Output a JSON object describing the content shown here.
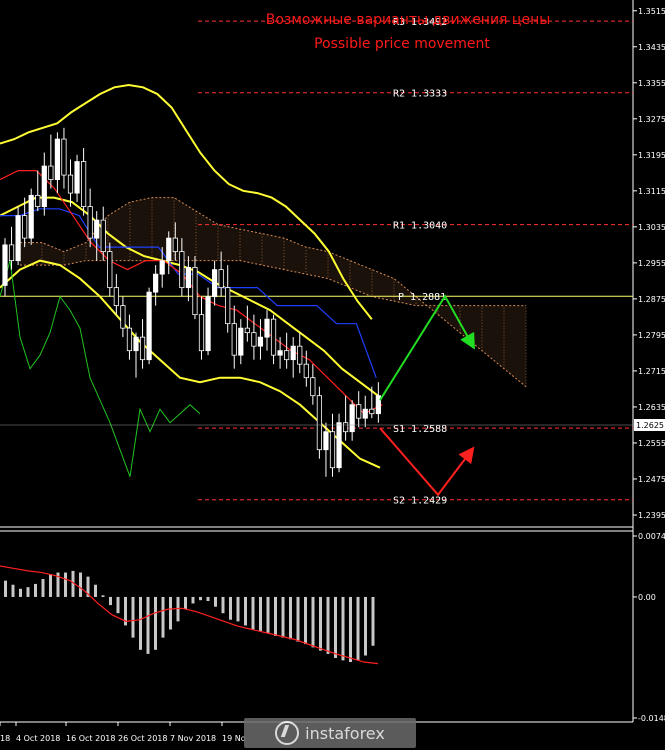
{
  "titles": {
    "ru": "Возможные варианты движения цены",
    "en": "Possible price movement"
  },
  "brand": "instaforex",
  "colors": {
    "background": "#000000",
    "bull_candle": "#ffffff",
    "bear_candle": "#000000",
    "bollinger": "#ffff33",
    "kijun": "#1f3fff",
    "tenkan": "#ff2020",
    "chikou": "#22c322",
    "cloud": "#d68a55",
    "levels": "#ff3030",
    "pivot": "#ffff66",
    "up_arrow": "#22dd22",
    "down_arrow": "#ff2020",
    "histogram": "#c8c8c8",
    "signal": "#ff2020"
  },
  "chart_data": [
    {
      "type": "candlestick",
      "pair_price_axis": {
        "ylim": [
          1.2375,
          1.353
        ],
        "ticks": [
          "1.3515",
          "1.3435",
          "1.3355",
          "1.3275",
          "1.3195",
          "1.3115",
          "1.3035",
          "1.2955",
          "1.2875",
          "1.2795",
          "1.2715",
          "1.2635",
          "1.2555",
          "1.2475",
          "1.2395"
        ],
        "current_price": "1.2625"
      },
      "x_labels": [
        "18",
        "4 Oct 2018",
        "16 Oct 2018",
        "26 Oct 2018",
        "7 Nov 2018",
        "19 No"
      ],
      "levels": [
        {
          "name": "R3",
          "value": 1.3492,
          "label": "R3 1.3492"
        },
        {
          "name": "R2",
          "value": 1.3333,
          "label": "R2 1.3333"
        },
        {
          "name": "R1",
          "value": 1.304,
          "label": "R1 1.3040"
        },
        {
          "name": "P",
          "value": 1.2881,
          "label": "P 1.2881"
        },
        {
          "name": "S1",
          "value": 1.2588,
          "label": "S1 1.2588"
        },
        {
          "name": "S2",
          "value": 1.2429,
          "label": "S2 1.2429"
        }
      ],
      "candles": [
        [
          1.2905,
          1.301,
          1.288,
          1.2995
        ],
        [
          1.2995,
          1.3035,
          1.294,
          1.296
        ],
        [
          1.296,
          1.308,
          1.295,
          1.306
        ],
        [
          1.306,
          1.31,
          1.299,
          1.301
        ],
        [
          1.301,
          1.312,
          1.2995,
          1.3105
        ],
        [
          1.3105,
          1.316,
          1.307,
          1.308
        ],
        [
          1.308,
          1.32,
          1.306,
          1.317
        ],
        [
          1.317,
          1.324,
          1.312,
          1.314
        ],
        [
          1.314,
          1.3245,
          1.311,
          1.323
        ],
        [
          1.323,
          1.3255,
          1.312,
          1.315
        ],
        [
          1.315,
          1.3185,
          1.308,
          1.311
        ],
        [
          1.311,
          1.3195,
          1.309,
          1.318
        ],
        [
          1.318,
          1.321,
          1.306,
          1.308
        ],
        [
          1.308,
          1.312,
          1.299,
          1.301
        ],
        [
          1.301,
          1.307,
          1.296,
          1.305
        ],
        [
          1.305,
          1.308,
          1.296,
          1.298
        ],
        [
          1.298,
          1.3,
          1.288,
          1.29
        ],
        [
          1.29,
          1.293,
          1.284,
          1.286
        ],
        [
          1.286,
          1.288,
          1.279,
          1.281
        ],
        [
          1.281,
          1.284,
          1.274,
          1.276
        ],
        [
          1.276,
          1.28,
          1.27,
          1.279
        ],
        [
          1.279,
          1.283,
          1.272,
          1.274
        ],
        [
          1.274,
          1.29,
          1.273,
          1.289
        ],
        [
          1.289,
          1.295,
          1.286,
          1.293
        ],
        [
          1.293,
          1.299,
          1.29,
          1.296
        ],
        [
          1.296,
          1.3025,
          1.293,
          1.301
        ],
        [
          1.301,
          1.3045,
          1.296,
          1.298
        ],
        [
          1.298,
          1.301,
          1.288,
          1.29
        ],
        [
          1.29,
          1.297,
          1.287,
          1.2945
        ],
        [
          1.2945,
          1.297,
          1.283,
          1.284
        ],
        [
          1.284,
          1.288,
          1.274,
          1.276
        ],
        [
          1.276,
          1.29,
          1.275,
          1.288
        ],
        [
          1.288,
          1.296,
          1.286,
          1.294
        ],
        [
          1.294,
          1.298,
          1.288,
          1.29
        ],
        [
          1.29,
          1.295,
          1.28,
          1.282
        ],
        [
          1.282,
          1.286,
          1.272,
          1.275
        ],
        [
          1.275,
          1.283,
          1.273,
          1.281
        ],
        [
          1.281,
          1.286,
          1.278,
          1.28
        ],
        [
          1.28,
          1.284,
          1.274,
          1.277
        ],
        [
          1.277,
          1.283,
          1.274,
          1.279
        ],
        [
          1.279,
          1.285,
          1.276,
          1.283
        ],
        [
          1.283,
          1.284,
          1.273,
          1.275
        ],
        [
          1.275,
          1.279,
          1.272,
          1.276
        ],
        [
          1.276,
          1.28,
          1.272,
          1.274
        ],
        [
          1.274,
          1.279,
          1.27,
          1.277
        ],
        [
          1.277,
          1.28,
          1.271,
          1.273
        ],
        [
          1.273,
          1.276,
          1.268,
          1.27
        ],
        [
          1.27,
          1.273,
          1.264,
          1.266
        ],
        [
          1.266,
          1.268,
          1.252,
          1.254
        ],
        [
          1.254,
          1.26,
          1.248,
          1.258
        ],
        [
          1.258,
          1.262,
          1.248,
          1.25
        ],
        [
          1.25,
          1.262,
          1.249,
          1.26
        ],
        [
          1.26,
          1.266,
          1.256,
          1.258
        ],
        [
          1.258,
          1.265,
          1.256,
          1.264
        ],
        [
          1.264,
          1.267,
          1.259,
          1.261
        ],
        [
          1.261,
          1.266,
          1.259,
          1.263
        ],
        [
          1.263,
          1.268,
          1.261,
          1.262
        ],
        [
          1.262,
          1.269,
          1.26,
          1.266
        ]
      ],
      "bollinger_upper": [
        1.322,
        1.323,
        1.3245,
        1.3255,
        1.3265,
        1.329,
        1.331,
        1.333,
        1.3345,
        1.335,
        1.3345,
        1.333,
        1.33,
        1.325,
        1.32,
        1.316,
        1.313,
        1.3115,
        1.311,
        1.31,
        1.308,
        1.305,
        1.302,
        1.298,
        1.292,
        1.287,
        1.283
      ],
      "bollinger_mid": [
        1.306,
        1.308,
        1.31,
        1.31,
        1.309,
        1.306,
        1.302,
        1.299,
        1.297,
        1.296,
        1.295,
        1.2935,
        1.291,
        1.289,
        1.287,
        1.285,
        1.282,
        1.279,
        1.276,
        1.272,
        1.269,
        1.266
      ],
      "bollinger_lower": [
        1.29,
        1.294,
        1.296,
        1.295,
        1.292,
        1.288,
        1.283,
        1.278,
        1.274,
        1.27,
        1.269,
        1.27,
        1.27,
        1.269,
        1.267,
        1.264,
        1.26,
        1.256,
        1.252,
        1.25
      ],
      "kijun": [
        1.306,
        1.306,
        1.3075,
        1.3075,
        1.306,
        1.299,
        1.299,
        1.299,
        1.299,
        1.293,
        1.293,
        1.29,
        1.29,
        1.29,
        1.286,
        1.286,
        1.286,
        1.282,
        1.282,
        1.27
      ],
      "tenkan": [
        1.314,
        1.316,
        1.316,
        1.312,
        1.306,
        1.3,
        1.296,
        1.294,
        1.296,
        1.296,
        1.293,
        1.288,
        1.286,
        1.285,
        1.282,
        1.279,
        1.276,
        1.274,
        1.27,
        1.266,
        1.262,
        1.264
      ],
      "chikou": [
        1.288,
        1.296,
        1.279,
        1.272,
        1.275,
        1.28,
        1.288,
        1.285,
        1.281,
        1.27,
        1.265,
        1.26,
        1.254,
        1.248,
        1.263,
        1.258,
        1.263,
        1.26,
        1.262,
        1.264,
        1.262
      ],
      "cloud_span_a": [
        1.3,
        1.3,
        1.298,
        1.3,
        1.306,
        1.309,
        1.31,
        1.31,
        1.307,
        1.304,
        1.303,
        1.302,
        1.301,
        1.299,
        1.298,
        1.296,
        1.294,
        1.292,
        1.288,
        1.284,
        1.28,
        1.276,
        1.272,
        1.268
      ],
      "cloud_span_b": [
        1.295,
        1.295,
        1.295,
        1.296,
        1.296,
        1.296,
        1.296,
        1.296,
        1.296,
        1.296,
        1.296,
        1.295,
        1.294,
        1.293,
        1.292,
        1.29,
        1.288,
        1.287,
        1.286,
        1.286,
        1.286,
        1.286,
        1.286,
        1.286
      ],
      "projection_up": [
        [
          1.265
        ],
        [
          1.2881
        ],
        [
          1.277
        ]
      ],
      "projection_down": [
        [
          1.2588
        ],
        [
          1.244
        ],
        [
          1.254
        ]
      ]
    },
    {
      "type": "histogram",
      "ylim": [
        -0.01488,
        0.00749
      ],
      "ticks": [
        "0.00749",
        "0.00",
        "-0.01488"
      ],
      "values": [
        0.002,
        0.0015,
        0.001,
        0.0012,
        0.0016,
        0.0022,
        0.0028,
        0.003,
        0.003,
        0.0032,
        0.003,
        0.0025,
        0.0015,
        0.0002,
        -0.001,
        -0.002,
        -0.0035,
        -0.005,
        -0.0065,
        -0.007,
        -0.0065,
        -0.005,
        -0.004,
        -0.003,
        -0.0015,
        -0.0008,
        -0.0004,
        -0.0005,
        -0.0012,
        -0.002,
        -0.0028,
        -0.003,
        -0.0035,
        -0.004,
        -0.0042,
        -0.0045,
        -0.0048,
        -0.005,
        -0.0052,
        -0.0055,
        -0.0058,
        -0.0062,
        -0.0066,
        -0.007,
        -0.0075,
        -0.0078,
        -0.008,
        -0.0078,
        -0.0072,
        -0.006
      ],
      "signal": [
        0.0038,
        0.0035,
        0.0032,
        0.003,
        0.0026,
        0.002,
        0.0008,
        -0.0008,
        -0.0022,
        -0.003,
        -0.0028,
        -0.002,
        -0.0015,
        -0.0014,
        -0.0018,
        -0.0024,
        -0.003,
        -0.0036,
        -0.004,
        -0.0044,
        -0.0048,
        -0.0052,
        -0.0058,
        -0.0064,
        -0.007,
        -0.0075,
        -0.008,
        -0.0082
      ]
    }
  ]
}
